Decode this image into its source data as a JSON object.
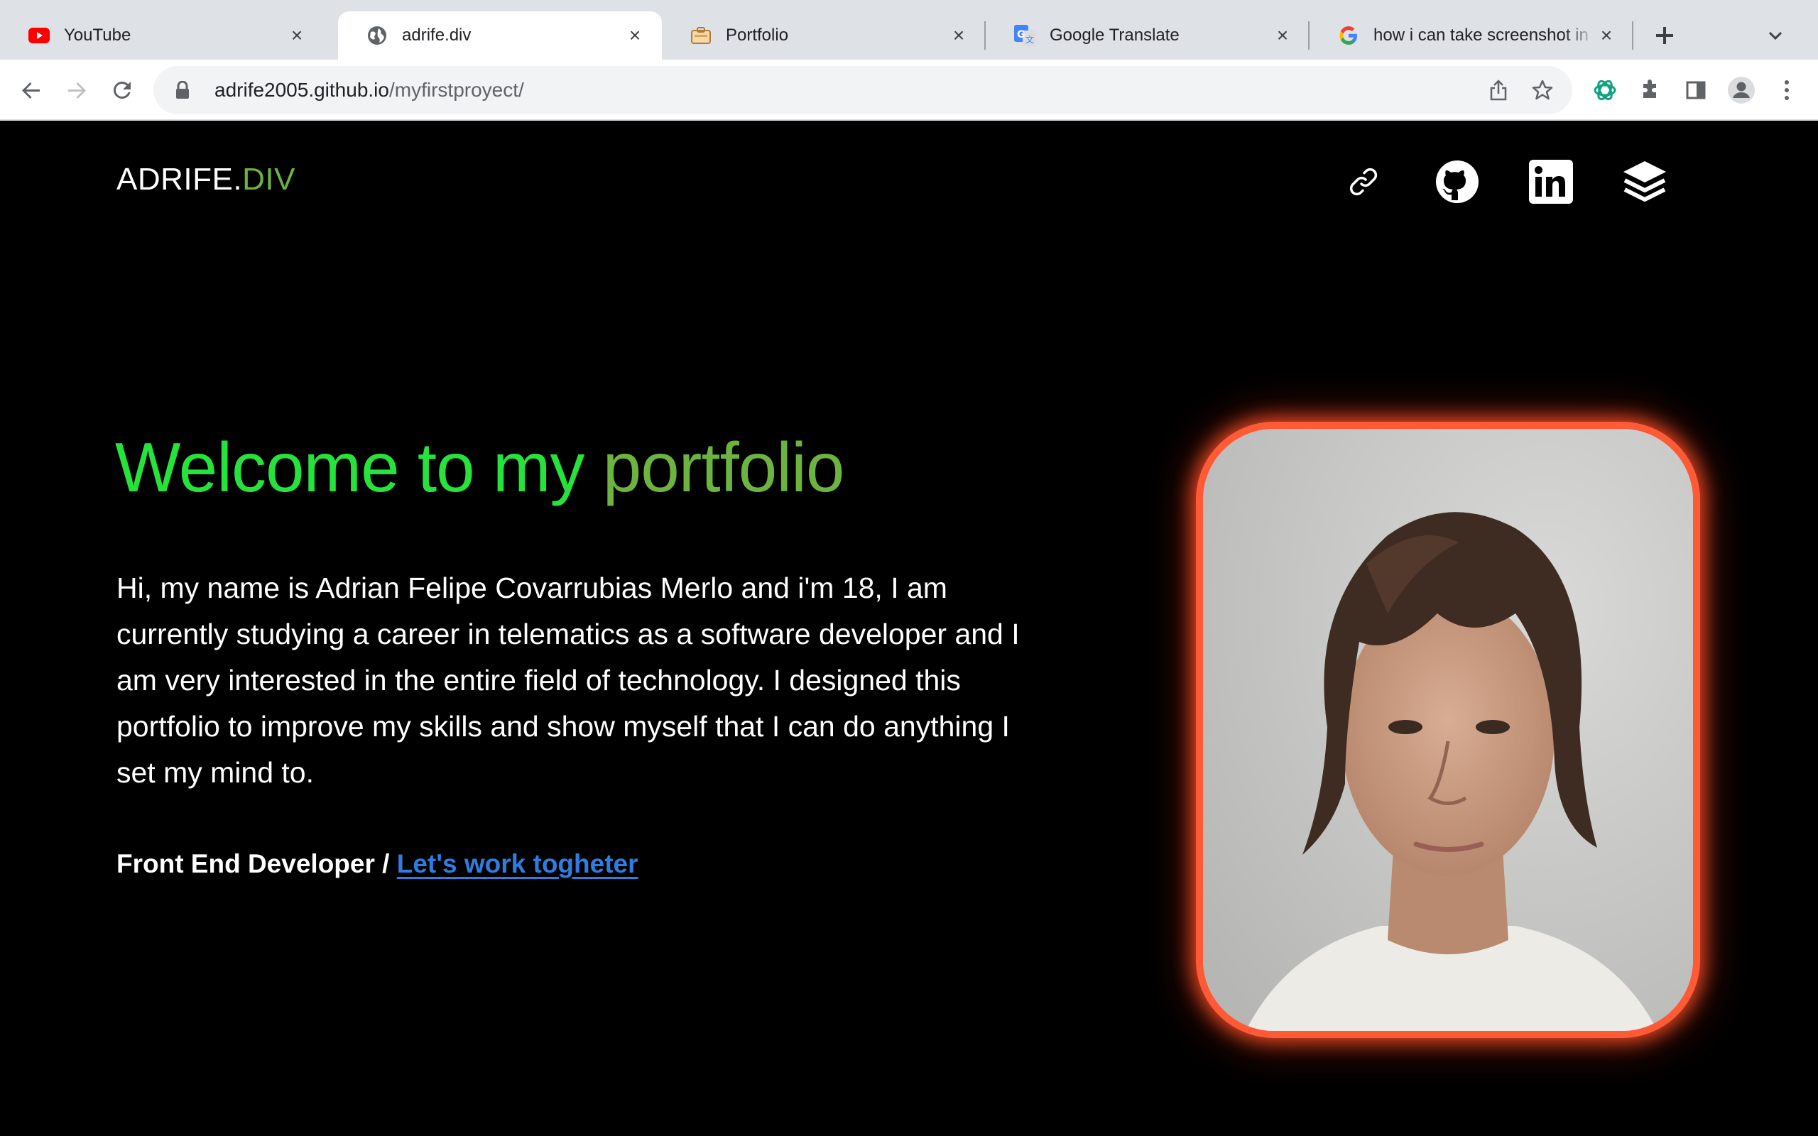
{
  "browser": {
    "tabs": [
      {
        "title": "YouTube",
        "icon": "youtube-icon",
        "active": false
      },
      {
        "title": "adrife.div",
        "icon": "globe-icon",
        "active": true
      },
      {
        "title": "Portfolio",
        "icon": "portfolio-icon",
        "active": false
      },
      {
        "title": "Google Translate",
        "icon": "google-translate-icon",
        "active": false
      },
      {
        "title": "how i can take screenshot in",
        "icon": "google-icon",
        "active": false
      }
    ],
    "url_host": "adrife2005.github.io",
    "url_path": "/myfirstproyect/"
  },
  "site": {
    "logo_main": "ADRIFE.",
    "logo_accent": "DIV",
    "social_icons": [
      "link-icon",
      "github-icon",
      "linkedin-icon",
      "layers-icon"
    ],
    "headline_part1": "Welcome to my ",
    "headline_part2": "portfolio",
    "bio": "Hi, my name is Adrian Felipe Covarrubias Merlo and i'm 18, I am currently studying a career in telematics as a software developer and I am very interested in the entire field of technology. I designed this portfolio to improve my skills and show myself that I can do anything I set my mind to.",
    "role": "Front End Developer / ",
    "cta_link": "Let's work togheter"
  },
  "colors": {
    "accent_green": "#26e33c",
    "accent_olive": "#6cb33f",
    "link_blue": "#2f7de1",
    "photo_border": "#ff5a36",
    "background": "#000000"
  }
}
